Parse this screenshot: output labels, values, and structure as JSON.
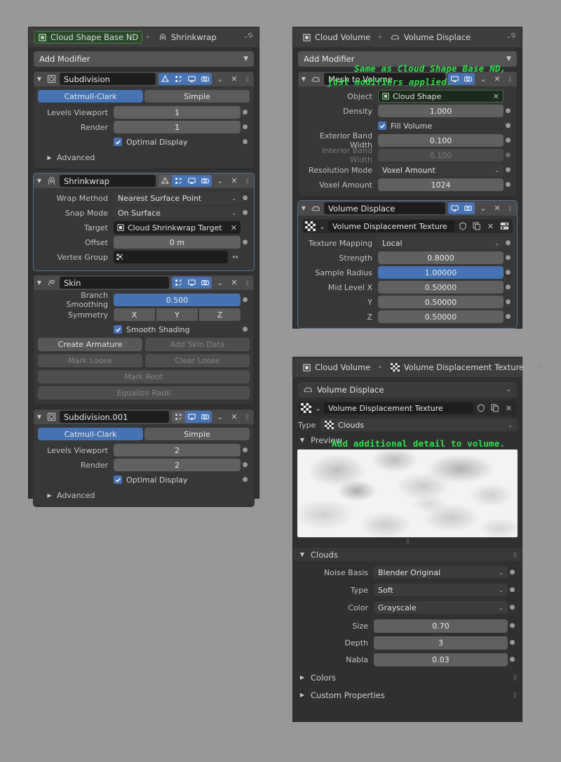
{
  "app": "blender-properties-editor",
  "colors": {
    "accent_blue": "#4772b3",
    "panel_bg": "#303030",
    "header_bg": "#3d3d3d",
    "annotation_green": "#2fe04a",
    "active_crumb_green": "#2a4a2a"
  },
  "annotations": [
    {
      "id": "anno-1",
      "text": "Same as Cloud Shape Base ND,"
    },
    {
      "id": "anno-2",
      "text": "just modifiers applied."
    },
    {
      "id": "anno-3",
      "text": "Add additional detail to volume."
    }
  ],
  "modifier_panel": {
    "breadcrumb": {
      "object": "Cloud Shape Base ND",
      "separator": "▸",
      "current": "Shrinkwrap",
      "pin_icon": "pin-icon"
    },
    "add_modifier_label": "Add Modifier",
    "modifiers": [
      {
        "name": "Subdivision",
        "icon": "subdivision-icon",
        "toggles": [
          {
            "name": "on-cage-icon",
            "on": true
          },
          {
            "name": "edit-mode-icon",
            "on": true
          },
          {
            "name": "realtime-display-icon",
            "on": true
          },
          {
            "name": "render-camera-icon",
            "on": true
          }
        ],
        "segmented": {
          "options": [
            "Catmull-Clark",
            "Simple"
          ],
          "selected": "Catmull-Clark"
        },
        "rows": [
          {
            "label": "Levels Viewport",
            "value": "1"
          },
          {
            "label": "Render",
            "value": "1"
          }
        ],
        "checkbox": {
          "label": "Optimal Display",
          "checked": true
        },
        "subsection": "Advanced"
      },
      {
        "name": "Shrinkwrap",
        "icon": "shrinkwrap-icon",
        "selected": true,
        "toggles": [
          {
            "name": "on-cage-icon",
            "on": false
          },
          {
            "name": "edit-mode-icon",
            "on": true
          },
          {
            "name": "realtime-display-icon",
            "on": true
          },
          {
            "name": "render-camera-icon",
            "on": true
          }
        ],
        "rows": [
          {
            "label": "Wrap Method",
            "value": "Nearest Surface Point",
            "type": "select"
          },
          {
            "label": "Snap Mode",
            "value": "On Surface",
            "type": "select"
          },
          {
            "label": "Target",
            "value": "Cloud Shrinkwrap Target",
            "type": "object"
          },
          {
            "label": "Offset",
            "value": "0 m",
            "type": "field"
          },
          {
            "label": "Vertex Group",
            "value": "",
            "type": "vertexgroup"
          }
        ]
      },
      {
        "name": "Skin",
        "icon": "skin-icon",
        "toggles": [
          {
            "name": "edit-mode-icon",
            "on": true
          },
          {
            "name": "realtime-display-icon",
            "on": true
          },
          {
            "name": "render-camera-icon",
            "on": true
          }
        ],
        "rows": [
          {
            "label": "Branch Smoothing",
            "value": "0.500",
            "type": "slider"
          }
        ],
        "symmetry": {
          "label": "Symmetry",
          "options": [
            "X",
            "Y",
            "Z"
          ]
        },
        "checkbox": {
          "label": "Smooth Shading",
          "checked": true
        },
        "buttons": [
          [
            {
              "label": "Create Armature",
              "enabled": true
            },
            {
              "label": "Add Skin Data",
              "enabled": false
            }
          ],
          [
            {
              "label": "Mark Loose",
              "enabled": false
            },
            {
              "label": "Clear Loose",
              "enabled": false
            }
          ],
          [
            {
              "label": "Mark Root",
              "enabled": false
            }
          ],
          [
            {
              "label": "Equalize Radii",
              "enabled": false
            }
          ]
        ]
      },
      {
        "name": "Subdivision.001",
        "icon": "subdivision-icon",
        "toggles": [
          {
            "name": "edit-mode-icon",
            "on": false
          },
          {
            "name": "realtime-display-icon",
            "on": true
          },
          {
            "name": "render-camera-icon",
            "on": true
          }
        ],
        "segmented": {
          "options": [
            "Catmull-Clark",
            "Simple"
          ],
          "selected": "Catmull-Clark"
        },
        "rows": [
          {
            "label": "Levels Viewport",
            "value": "2"
          },
          {
            "label": "Render",
            "value": "2"
          }
        ],
        "checkbox": {
          "label": "Optimal Display",
          "checked": true
        },
        "subsection": "Advanced"
      }
    ]
  },
  "volume_panel": {
    "breadcrumb": {
      "object": "Cloud Volume",
      "separator": "▸",
      "current": "Volume Displace",
      "pin_icon": "pin-icon"
    },
    "add_modifier_label": "Add Modifier",
    "mesh_to_volume": {
      "name": "Mesh to Volume",
      "icon": "volume-icon",
      "rows": [
        {
          "label": "Object",
          "value": "Cloud Shape",
          "type": "object"
        },
        {
          "label": "Density",
          "value": "1.000",
          "type": "field"
        },
        {
          "label": "Exterior Band Width",
          "value": "0.100",
          "type": "field"
        },
        {
          "label": "Interior Band Width",
          "value": "0.100",
          "type": "field",
          "disabled": true
        },
        {
          "label": "Resolution Mode",
          "value": "Voxel Amount",
          "type": "select"
        },
        {
          "label": "Voxel Amount",
          "value": "1024",
          "type": "field"
        }
      ],
      "checkbox": {
        "label": "Fill Volume",
        "checked": true
      }
    },
    "volume_displace": {
      "name": "Volume Displace",
      "icon": "volume-icon",
      "toggles": [
        {
          "name": "realtime-display-icon",
          "on": true
        },
        {
          "name": "render-camera-icon",
          "on": true
        }
      ],
      "texture_name": "Volume Displacement Texture",
      "rows": [
        {
          "label": "Texture Mapping",
          "value": "Local",
          "type": "select"
        },
        {
          "label": "Strength",
          "value": "0.8000",
          "type": "field"
        },
        {
          "label": "Sample Radius",
          "value": "1.00000",
          "type": "slider"
        },
        {
          "label": "Mid Level X",
          "value": "0.50000",
          "type": "field"
        },
        {
          "label": "Y",
          "value": "0.50000",
          "type": "field"
        },
        {
          "label": "Z",
          "value": "0.50000",
          "type": "field"
        }
      ]
    }
  },
  "texture_panel": {
    "breadcrumb": {
      "object": "Cloud Volume",
      "separator": "▸",
      "current": "Volume Displacement Texture",
      "pin_icon": "pin-icon"
    },
    "modifier_select": "Volume Displace",
    "texture_name": "Volume Displacement Texture",
    "type_label": "Type",
    "type_value": "Clouds",
    "preview_label": "Preview",
    "clouds_section": {
      "title": "Clouds",
      "rows": [
        {
          "label": "Noise Basis",
          "value": "Blender Original",
          "type": "select"
        },
        {
          "label": "Type",
          "value": "Soft",
          "type": "select"
        },
        {
          "label": "Color",
          "value": "Grayscale",
          "type": "select"
        },
        {
          "label": "Size",
          "value": "0.70",
          "type": "field"
        },
        {
          "label": "Depth",
          "value": "3",
          "type": "field"
        },
        {
          "label": "Nabla",
          "value": "0.03",
          "type": "field"
        }
      ]
    },
    "collapsed_sections": [
      "Colors",
      "Custom Properties"
    ]
  }
}
